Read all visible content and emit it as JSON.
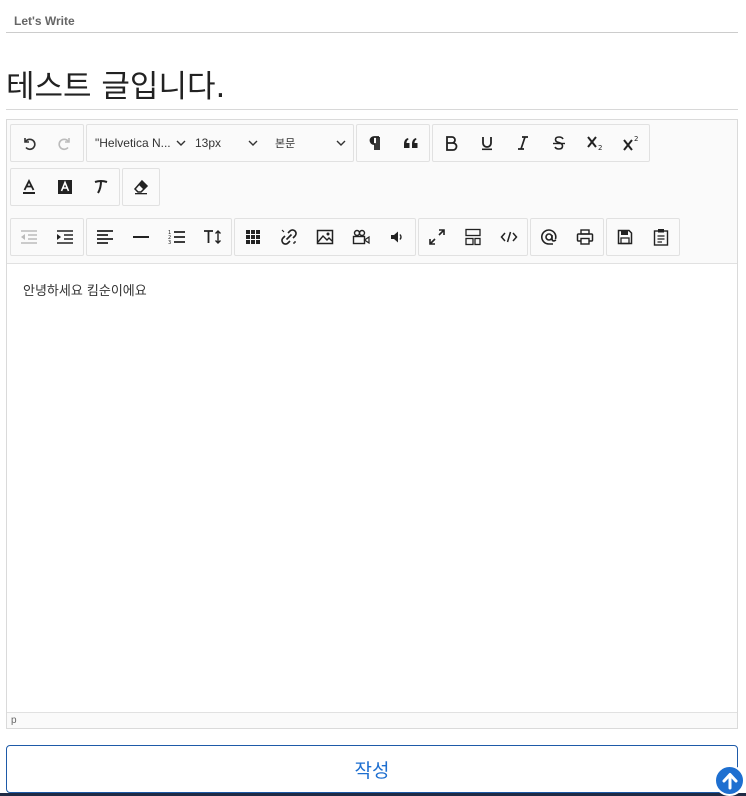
{
  "page": {
    "label": "Let's Write"
  },
  "form": {
    "title_value": "테스트 글입니다.",
    "body_text": "안녕하세요 킴순이에요",
    "submit_label": "작성"
  },
  "toolbar": {
    "font_family": "\"Helvetica N...",
    "font_size": "13px",
    "format_block": "본문",
    "buttons": [
      "undo-icon",
      "redo-icon",
      "paragraph-icon",
      "blockquote-icon",
      "bold-icon",
      "underline-icon",
      "italic-icon",
      "strikethrough-icon",
      "subscript-icon",
      "superscript-icon",
      "font-color-icon",
      "highlight-color-icon",
      "text-style-icon",
      "remove-format-icon",
      "outdent-icon",
      "indent-icon",
      "align-icon",
      "horizontal-rule-icon",
      "list-icon",
      "line-height-icon",
      "table-icon",
      "link-icon",
      "image-icon",
      "video-icon",
      "audio-icon",
      "fullscreen-icon",
      "show-blocks-icon",
      "code-view-icon",
      "mention-icon",
      "print-icon",
      "save-icon",
      "template-icon"
    ]
  },
  "statusbar": {
    "path": "p"
  },
  "colors": {
    "accent": "#1e6fd0",
    "border": "#dadada",
    "toolbar_bg": "#fafafa"
  }
}
